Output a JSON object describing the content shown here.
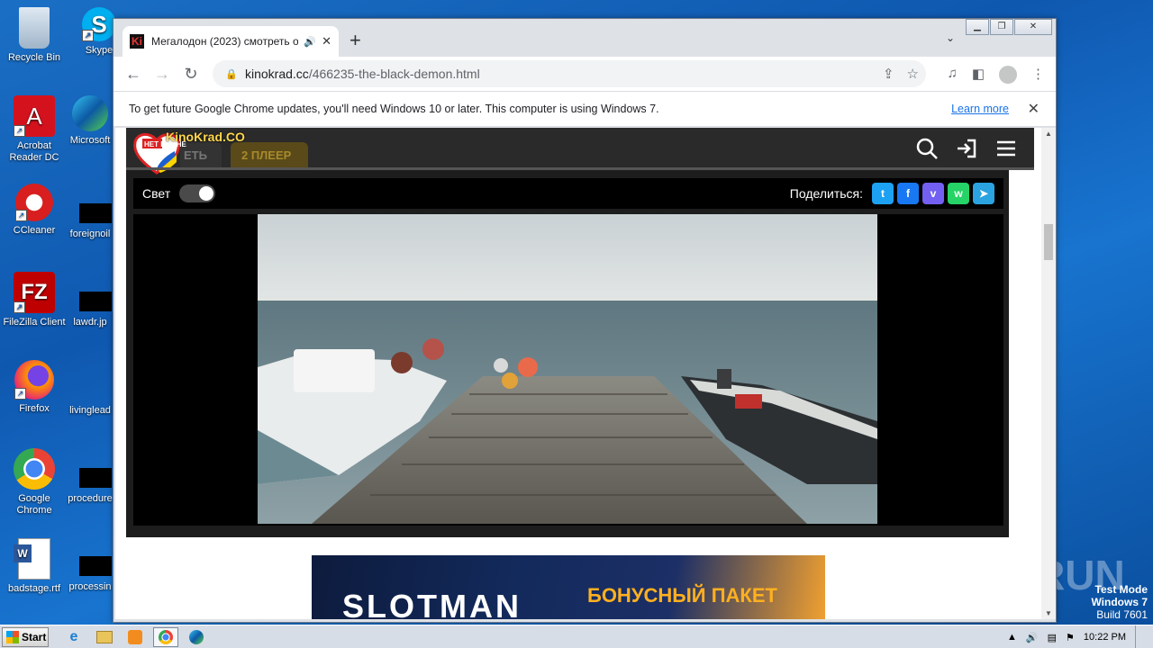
{
  "desktop": {
    "icons": [
      {
        "label": "Recycle Bin"
      },
      {
        "label": "Skype"
      },
      {
        "label": "Acrobat Reader DC"
      },
      {
        "label": "Microsoft"
      },
      {
        "label": "CCleaner"
      },
      {
        "label": "foreignoil"
      },
      {
        "label": "FileZilla Client"
      },
      {
        "label": "lawdr.jp"
      },
      {
        "label": "Firefox"
      },
      {
        "label": "livinglead"
      },
      {
        "label": "Google Chrome"
      },
      {
        "label": "procedure"
      },
      {
        "label": "badstage.rtf"
      },
      {
        "label": "processin"
      }
    ],
    "test_mode": {
      "line1": "Test Mode",
      "line2": "Windows 7",
      "line3": "Build 7601"
    },
    "watermark": "ANY RUN"
  },
  "browser": {
    "tab": {
      "title": "Мегалодон (2023) смотреть о",
      "favicon": "Ki"
    },
    "address": {
      "host": "kinokrad.cc",
      "path": "/466235-the-black-demon.html"
    },
    "infobar": {
      "message": "To get future Google Chrome updates, you'll need Windows 10 or later. This computer is using Windows 7.",
      "link": "Learn more"
    }
  },
  "site": {
    "logo_badge": "НЕТ ВОЙНЕ",
    "logo_text": "KinoKrad.CO",
    "tab1": "ЕТЬ",
    "tab2": "2 ПЛЕЕР",
    "light_label": "Свет",
    "share_label": "Поделиться:",
    "share_buttons": [
      {
        "name": "twitter",
        "color": "#1da1f2",
        "glyph": "t"
      },
      {
        "name": "facebook",
        "color": "#1877f2",
        "glyph": "f"
      },
      {
        "name": "viber",
        "color": "#7360f2",
        "glyph": "v"
      },
      {
        "name": "whatsapp",
        "color": "#25d366",
        "glyph": "w"
      },
      {
        "name": "telegram",
        "color": "#2aa3e0",
        "glyph": "➤"
      }
    ],
    "ad": {
      "brand": "SLOTMAN",
      "offer": "БОНУСНЫЙ ПАКЕТ"
    }
  },
  "taskbar": {
    "start": "Start",
    "clock": "10:22 PM"
  }
}
